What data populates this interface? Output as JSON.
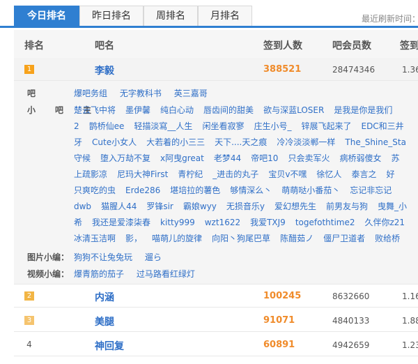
{
  "tabs": [
    "今日排名",
    "昨日排名",
    "周排名",
    "月排名"
  ],
  "refresh_label": "最近刷新时间：",
  "columns": [
    "排名",
    "吧名",
    "签到人数",
    "吧会员数",
    "签到"
  ],
  "rows": [
    {
      "rank": "1",
      "name": "李毅",
      "sign_in": "388521",
      "members": "28474346",
      "ratio": "1.36",
      "badge_color": "#f7a21b"
    },
    {
      "rank": "2",
      "name": "内涵",
      "sign_in": "100245",
      "members": "8632660",
      "ratio": "1.16",
      "badge_color": "#f2b544"
    },
    {
      "rank": "3",
      "name": "美腿",
      "sign_in": "91071",
      "members": "4840133",
      "ratio": "1.88",
      "badge_color": "#f5c46e"
    },
    {
      "rank": "4",
      "name": "神回复",
      "sign_in": "60891",
      "members": "4942659",
      "ratio": "1.23",
      "badge_color": ""
    }
  ],
  "detail": {
    "ba_label": "吧",
    "ba_links": [
      "爆吧务组",
      "无字教科书",
      "英三嘉哥"
    ],
    "xiaoba_label": "小吧主",
    "xiaoba_lines": [
      [
        "楚云飞中将",
        "墨伊馨",
        "纯白心动",
        "唇齿间的甜美",
        "欲与深蓝LOSER",
        "是我是你是我们"
      ],
      [
        "2",
        "鹊桥仙ee",
        "轻描淡寫__人生",
        "闲坐看寂寥",
        "庄生小号_",
        "锌展飞起来了",
        "EDC和三井"
      ],
      [
        "牙",
        "Cute小女人",
        "大若着的小三三",
        "天下....天之痕",
        "冷冷淡淡郸一样",
        "The_Shine_Sta"
      ],
      [
        "守候",
        "堕入万劫不复",
        "x阿曳great",
        "老梦44",
        "帝吧10",
        "只会卖军火",
        "病桥弱傻女",
        "苏"
      ],
      [
        "上疏影凉",
        "尼玛大神First",
        "青柠纪",
        "_进击的丸子",
        "宝贝v不嘿",
        "徐忆人",
        "泰言之",
        "好"
      ],
      [
        "只爽吃的虫",
        "Erde286",
        "堪培拉的薯色",
        "够情深么丶",
        "萌萌哒小番茄丶",
        "忘记非忘记"
      ],
      [
        "dwb",
        "猫腥人44",
        "罗锋sir",
        "霸娘wyy",
        "无损音乐y",
        "爱幻想先生",
        "前男友与狗",
        "曳舞_小"
      ],
      [
        "希",
        "我还是爱漆柒春",
        "kitty999",
        "wzt1622",
        "我爱TXJ9",
        "togefothtime2",
        "久伴你z21"
      ],
      [
        "冰清玉洁啊",
        "影，",
        "喵萌儿的旋律",
        "向阳丶狗尾巴草",
        "陈醋茹ノ",
        "僵尸卫道者",
        "败给桥"
      ]
    ],
    "pic_label": "图片小编：",
    "pic_links": [
      "狗狗不让兔兔玩",
      "遛ら"
    ],
    "video_label": "视频小编：",
    "video_links": [
      "爆青筋的茄子",
      "过马路看红绿灯"
    ]
  }
}
